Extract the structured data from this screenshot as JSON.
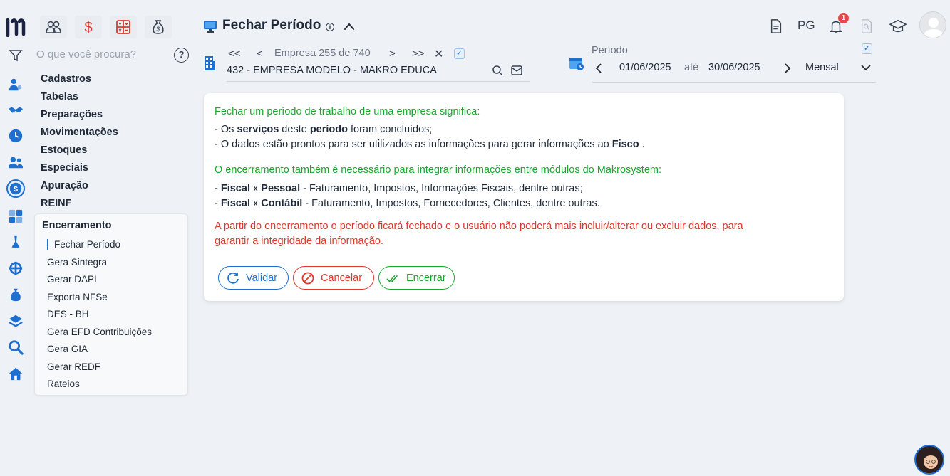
{
  "header": {
    "title": "Fechar Período",
    "info_icon": "i",
    "pg_label": "PG",
    "notification_count": "1"
  },
  "search": {
    "placeholder": "O que você procura?",
    "help_label": "?"
  },
  "menu": {
    "items": [
      "Cadastros",
      "Tabelas",
      "Preparações",
      "Movimentações",
      "Estoques",
      "Especiais",
      "Apuração",
      "REINF"
    ],
    "open_section": "Encerramento",
    "sub_items": [
      "Fechar Período",
      "Gera Sintegra",
      "Gerar DAPI",
      "Exporta NFSe",
      "DES - BH",
      "Gera EFD Contribuições",
      "Gera GIA",
      "Gerar REDF",
      "Rateios"
    ],
    "active_sub_item": "Fechar Período"
  },
  "company_nav": {
    "first": "<<",
    "prev": "<",
    "label": "Empresa",
    "current": "255",
    "of": "de",
    "total": "740",
    "next": ">",
    "last": ">>",
    "clear": "✕",
    "company": "432 - EMPRESA MODELO - MAKRO EDUCA"
  },
  "period": {
    "label": "Período",
    "start": "01/06/2025",
    "separator": "até",
    "end": "30/06/2025",
    "type": "Mensal"
  },
  "card": {
    "heading1": "Fechar um período de trabalho de uma empresa significa:",
    "line1_a": "- Os ",
    "line1_b": "serviços",
    "line1_c": " deste ",
    "line1_d": "período",
    "line1_e": " foram concluídos;",
    "line2_a": "- O dados estão prontos para ser utilizados as informações para gerar informações ao ",
    "line2_b": "Fisco",
    "line2_c": " .",
    "heading2": "O encerramento também é necessário para integrar informações entre módulos do Makrosystem:",
    "line3_a": "- ",
    "line3_b": "Fiscal",
    "line3_c": " x ",
    "line3_d": "Pessoal",
    "line3_e": " - Faturamento, Impostos, Informações Fiscais, dentre outras;",
    "line4_a": "- ",
    "line4_b": "Fiscal",
    "line4_c": " x ",
    "line4_d": "Contábil",
    "line4_e": " - Faturamento, Impostos, Fornecedores, Clientes, dentre outras.",
    "warning_line1": "A partir do encerramento o período ficará fechado e o usuário não poderá mais incluir/alterar ou excluir dados, para",
    "warning_line2": "garantir a integridade da informação.",
    "buttons": {
      "validar": "Validar",
      "cancelar": "Cancelar",
      "encerrar": "Encerrar"
    }
  },
  "colors": {
    "accent": "#1f6fd1",
    "success": "#18a82c",
    "danger": "#e0372b",
    "background": "#eef2f7"
  }
}
